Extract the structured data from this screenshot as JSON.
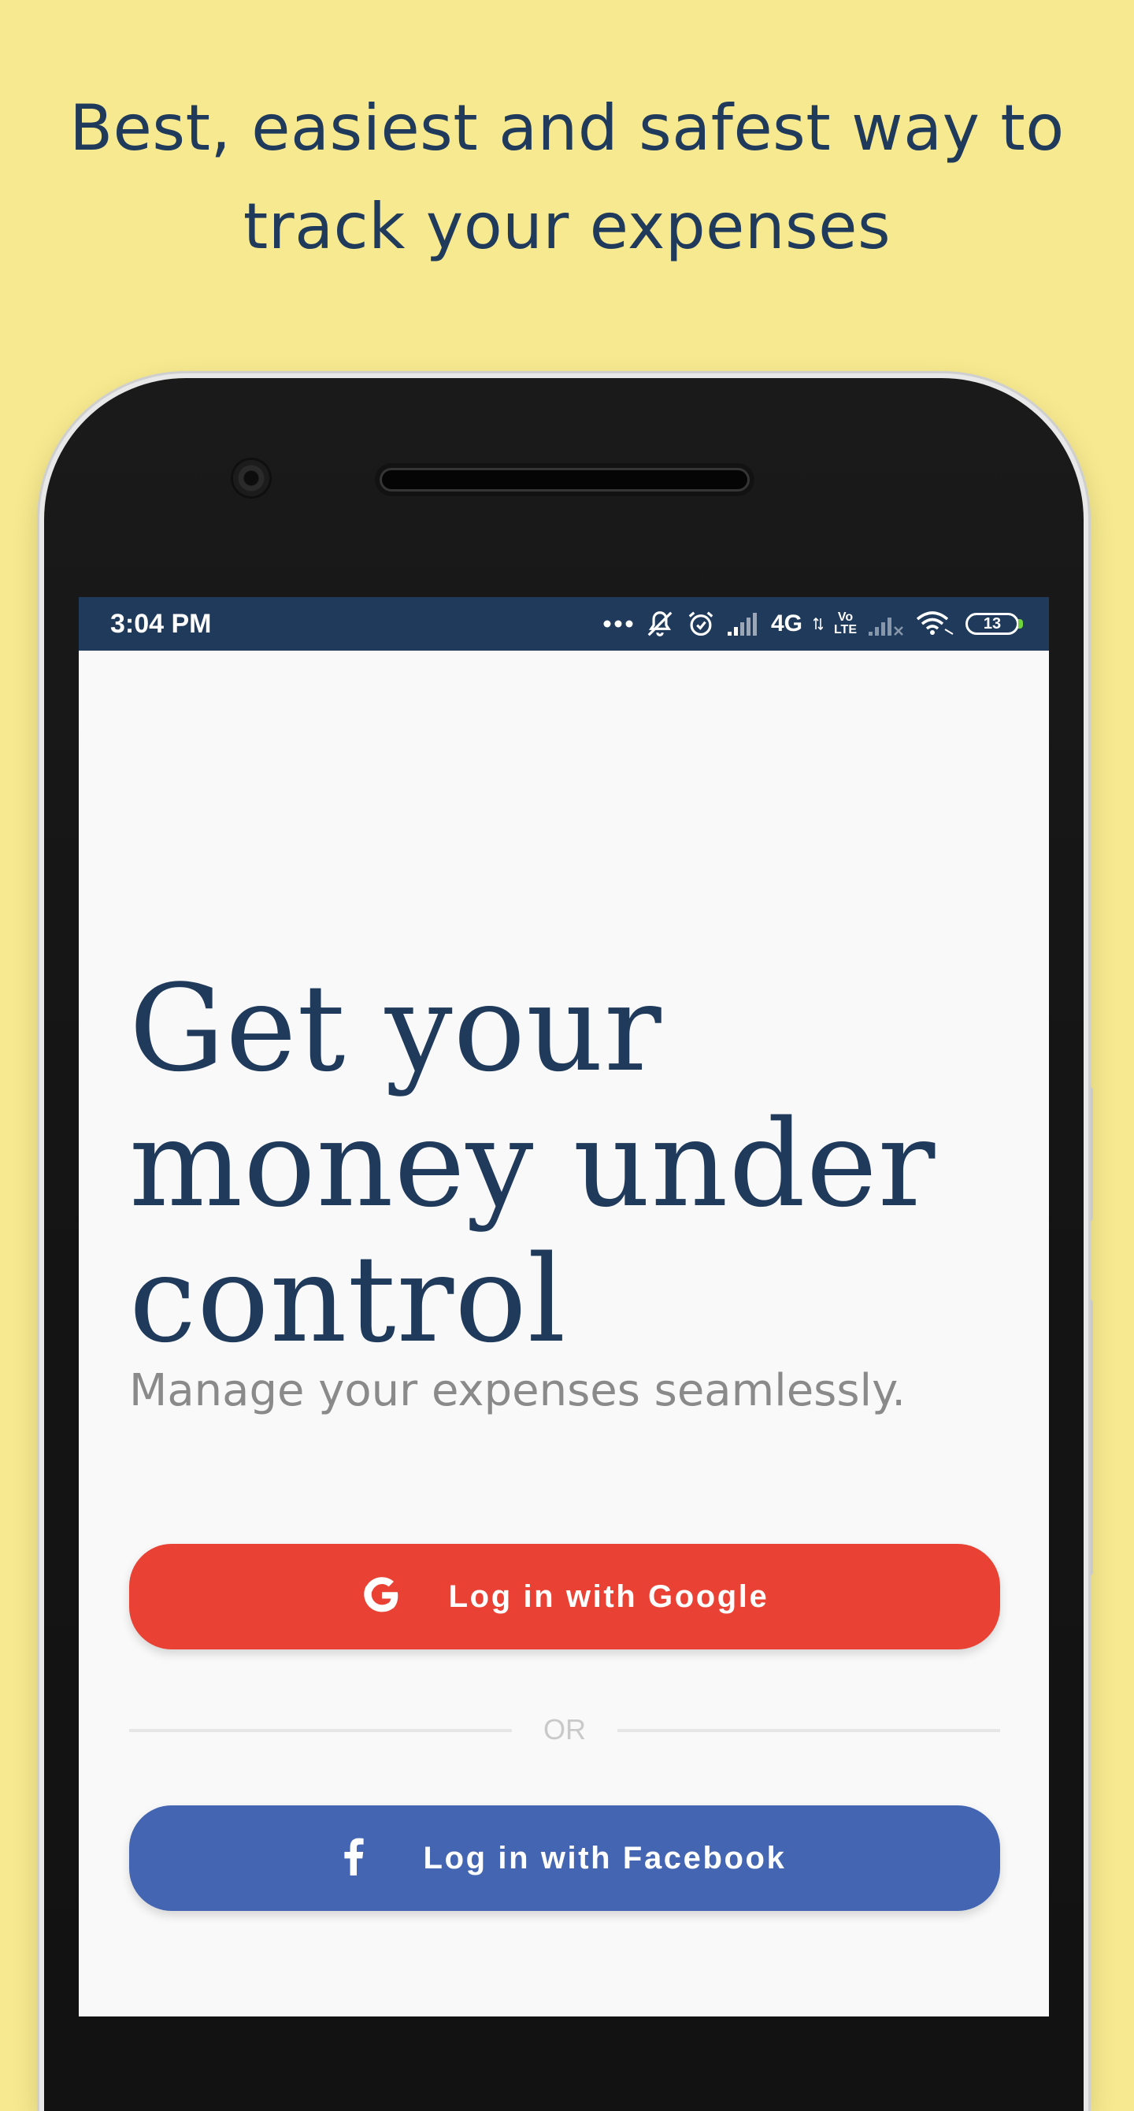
{
  "promo": {
    "headline_line1": "Best, easiest and safest way to",
    "headline_line2": "track your expenses"
  },
  "status_bar": {
    "time": "3:04 PM",
    "network": "4G",
    "volte_top": "Vo",
    "volte_bottom": "LTE",
    "battery": "13",
    "icons": [
      "more-dots-icon",
      "notifications-off-icon",
      "alarm-icon",
      "signal-icon",
      "data-arrows-icon",
      "signal-weak-icon",
      "wifi-icon",
      "battery-icon"
    ]
  },
  "hero": {
    "title_line1": "Get your",
    "title_line2": "money under",
    "title_line3": "control",
    "subtitle": "Manage your expenses seamlessly."
  },
  "auth": {
    "google_label": "Log in with Google",
    "divider_text": "OR",
    "facebook_label": "Log in with Facebook"
  },
  "colors": {
    "background": "#f6e98f",
    "primary_navy": "#203a5b",
    "google_red": "#e94235",
    "facebook_blue": "#4465b2",
    "screen_bg": "#f9f9f9",
    "subtitle_gray": "#8a8a8a"
  }
}
